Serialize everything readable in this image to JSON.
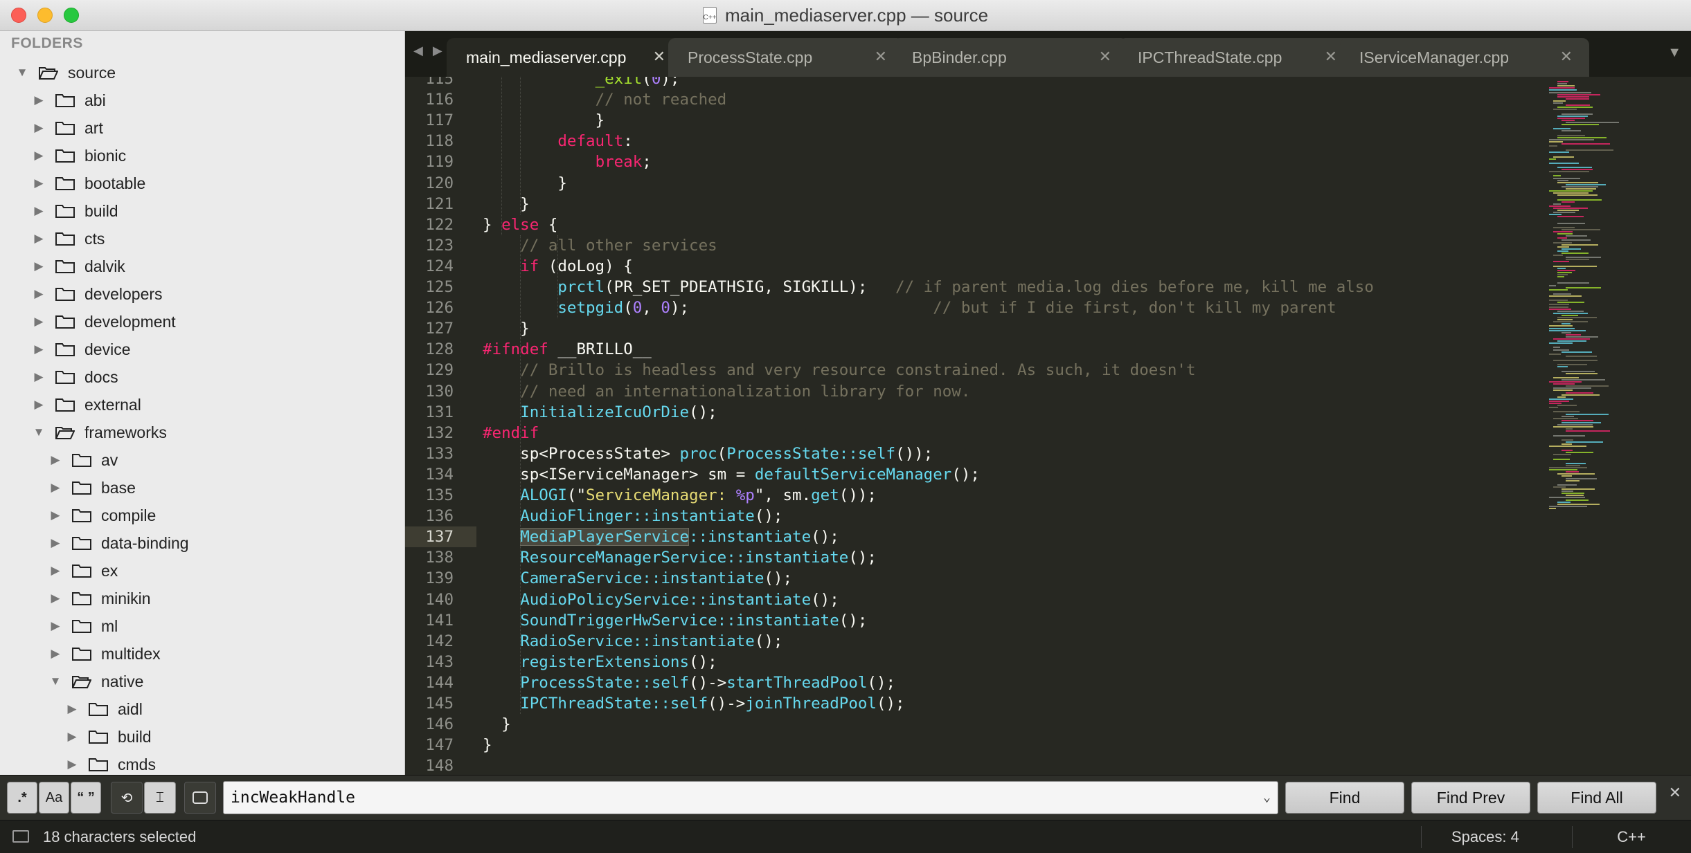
{
  "window": {
    "title": "main_mediaserver.cpp — source",
    "file_icon_label": "C++"
  },
  "sidebar": {
    "header": "FOLDERS",
    "items": [
      {
        "label": "source",
        "depth": 0,
        "open": true
      },
      {
        "label": "abi",
        "depth": 1,
        "open": false
      },
      {
        "label": "art",
        "depth": 1,
        "open": false
      },
      {
        "label": "bionic",
        "depth": 1,
        "open": false
      },
      {
        "label": "bootable",
        "depth": 1,
        "open": false
      },
      {
        "label": "build",
        "depth": 1,
        "open": false
      },
      {
        "label": "cts",
        "depth": 1,
        "open": false
      },
      {
        "label": "dalvik",
        "depth": 1,
        "open": false
      },
      {
        "label": "developers",
        "depth": 1,
        "open": false
      },
      {
        "label": "development",
        "depth": 1,
        "open": false
      },
      {
        "label": "device",
        "depth": 1,
        "open": false
      },
      {
        "label": "docs",
        "depth": 1,
        "open": false
      },
      {
        "label": "external",
        "depth": 1,
        "open": false
      },
      {
        "label": "frameworks",
        "depth": 1,
        "open": true
      },
      {
        "label": "av",
        "depth": 2,
        "open": false
      },
      {
        "label": "base",
        "depth": 2,
        "open": false
      },
      {
        "label": "compile",
        "depth": 2,
        "open": false
      },
      {
        "label": "data-binding",
        "depth": 2,
        "open": false
      },
      {
        "label": "ex",
        "depth": 2,
        "open": false
      },
      {
        "label": "minikin",
        "depth": 2,
        "open": false
      },
      {
        "label": "ml",
        "depth": 2,
        "open": false
      },
      {
        "label": "multidex",
        "depth": 2,
        "open": false
      },
      {
        "label": "native",
        "depth": 2,
        "open": true
      },
      {
        "label": "aidl",
        "depth": 3,
        "open": false
      },
      {
        "label": "build",
        "depth": 3,
        "open": false
      },
      {
        "label": "cmds",
        "depth": 3,
        "open": false
      }
    ]
  },
  "tabs": [
    {
      "label": "main_mediaserver.cpp",
      "active": true
    },
    {
      "label": "ProcessState.cpp",
      "active": false
    },
    {
      "label": "BpBinder.cpp",
      "active": false
    },
    {
      "label": "IPCThreadState.cpp",
      "active": false
    },
    {
      "label": "IServiceManager.cpp",
      "active": false
    }
  ],
  "editor": {
    "current_line": 137,
    "lines": [
      {
        "n": 115,
        "segs": [
          [
            "",
            "            "
          ],
          [
            "c-call",
            "_exit"
          ],
          [
            "",
            "("
          ],
          [
            "c-num",
            "0"
          ],
          [
            "",
            ");"
          ]
        ]
      },
      {
        "n": 116,
        "segs": [
          [
            "",
            "            "
          ],
          [
            "c-cm",
            "// not reached"
          ]
        ]
      },
      {
        "n": 117,
        "segs": [
          [
            "",
            "            }"
          ]
        ]
      },
      {
        "n": 118,
        "segs": [
          [
            "",
            "        "
          ],
          [
            "c-kw",
            "default"
          ],
          [
            "",
            ":"
          ]
        ]
      },
      {
        "n": 119,
        "segs": [
          [
            "",
            "            "
          ],
          [
            "c-kw",
            "break"
          ],
          [
            "",
            ";"
          ]
        ]
      },
      {
        "n": 120,
        "segs": [
          [
            "",
            "        }"
          ]
        ]
      },
      {
        "n": 121,
        "segs": [
          [
            "",
            "    }"
          ]
        ]
      },
      {
        "n": 122,
        "segs": [
          [
            "",
            "} "
          ],
          [
            "c-kw",
            "else"
          ],
          [
            "",
            " {"
          ]
        ]
      },
      {
        "n": 123,
        "segs": [
          [
            "",
            "    "
          ],
          [
            "c-cm",
            "// all other services"
          ]
        ]
      },
      {
        "n": 124,
        "segs": [
          [
            "",
            "    "
          ],
          [
            "c-kw",
            "if"
          ],
          [
            "",
            " (doLog) {"
          ]
        ]
      },
      {
        "n": 125,
        "segs": [
          [
            "",
            "        "
          ],
          [
            "c-fn",
            "prctl"
          ],
          [
            "",
            "(PR_SET_PDEATHSIG, SIGKILL);   "
          ],
          [
            "c-cm",
            "// if parent media.log dies before me, kill me also"
          ]
        ]
      },
      {
        "n": 126,
        "segs": [
          [
            "",
            "        "
          ],
          [
            "c-fn",
            "setpgid"
          ],
          [
            "",
            "("
          ],
          [
            "c-num",
            "0"
          ],
          [
            "",
            ", "
          ],
          [
            "c-num",
            "0"
          ],
          [
            "",
            ");                          "
          ],
          [
            "c-cm",
            "// but if I die first, don't kill my parent"
          ]
        ]
      },
      {
        "n": 127,
        "segs": [
          [
            "",
            "    }"
          ]
        ]
      },
      {
        "n": 128,
        "segs": [
          [
            "c-kw",
            "#ifndef"
          ],
          [
            "",
            " __BRILLO__"
          ]
        ]
      },
      {
        "n": 129,
        "segs": [
          [
            "",
            "    "
          ],
          [
            "c-cm",
            "// Brillo is headless and very resource constrained. As such, it doesn't"
          ]
        ]
      },
      {
        "n": 130,
        "segs": [
          [
            "",
            "    "
          ],
          [
            "c-cm",
            "// need an internationalization library for now."
          ]
        ]
      },
      {
        "n": 131,
        "segs": [
          [
            "",
            "    "
          ],
          [
            "c-fn",
            "InitializeIcuOrDie"
          ],
          [
            "",
            "();"
          ]
        ]
      },
      {
        "n": 132,
        "segs": [
          [
            "c-kw",
            "#endif"
          ]
        ]
      },
      {
        "n": 133,
        "segs": [
          [
            "",
            "    sp<ProcessState> "
          ],
          [
            "c-fn",
            "proc"
          ],
          [
            "",
            "("
          ],
          [
            "c-fn",
            "ProcessState::self"
          ],
          [
            "",
            "());"
          ]
        ]
      },
      {
        "n": 134,
        "segs": [
          [
            "",
            "    sp<IServiceManager> sm = "
          ],
          [
            "c-fn",
            "defaultServiceManager"
          ],
          [
            "",
            "();"
          ]
        ]
      },
      {
        "n": 135,
        "segs": [
          [
            "",
            "    "
          ],
          [
            "c-fn",
            "ALOGI"
          ],
          [
            "",
            "(\""
          ],
          [
            "c-str",
            "ServiceManager: "
          ],
          [
            "c-fmt",
            "%p"
          ],
          [
            "",
            "\", sm."
          ],
          [
            "c-fn",
            "get"
          ],
          [
            "",
            "());"
          ]
        ]
      },
      {
        "n": 136,
        "segs": [
          [
            "",
            "    "
          ],
          [
            "c-fn",
            "AudioFlinger::instantiate"
          ],
          [
            "",
            "();"
          ]
        ]
      },
      {
        "n": 137,
        "segs": [
          [
            "",
            "    "
          ],
          [
            "c-fn sel",
            "MediaPlayerService"
          ],
          [
            "c-fn",
            "::instantiate"
          ],
          [
            "",
            "();"
          ]
        ]
      },
      {
        "n": 138,
        "segs": [
          [
            "",
            "    "
          ],
          [
            "c-fn",
            "ResourceManagerService::instantiate"
          ],
          [
            "",
            "();"
          ]
        ]
      },
      {
        "n": 139,
        "segs": [
          [
            "",
            "    "
          ],
          [
            "c-fn",
            "CameraService::instantiate"
          ],
          [
            "",
            "();"
          ]
        ]
      },
      {
        "n": 140,
        "segs": [
          [
            "",
            "    "
          ],
          [
            "c-fn",
            "AudioPolicyService::instantiate"
          ],
          [
            "",
            "();"
          ]
        ]
      },
      {
        "n": 141,
        "segs": [
          [
            "",
            "    "
          ],
          [
            "c-fn",
            "SoundTriggerHwService::instantiate"
          ],
          [
            "",
            "();"
          ]
        ]
      },
      {
        "n": 142,
        "segs": [
          [
            "",
            "    "
          ],
          [
            "c-fn",
            "RadioService::instantiate"
          ],
          [
            "",
            "();"
          ]
        ]
      },
      {
        "n": 143,
        "segs": [
          [
            "",
            "    "
          ],
          [
            "c-fn",
            "registerExtensions"
          ],
          [
            "",
            "();"
          ]
        ]
      },
      {
        "n": 144,
        "segs": [
          [
            "",
            "    "
          ],
          [
            "c-fn",
            "ProcessState::self"
          ],
          [
            "",
            "()->"
          ],
          [
            "c-fn",
            "startThreadPool"
          ],
          [
            "",
            "();"
          ]
        ]
      },
      {
        "n": 145,
        "segs": [
          [
            "",
            "    "
          ],
          [
            "c-fn",
            "IPCThreadState::self"
          ],
          [
            "",
            "()->"
          ],
          [
            "c-fn",
            "joinThreadPool"
          ],
          [
            "",
            "();"
          ]
        ]
      },
      {
        "n": 146,
        "segs": [
          [
            "",
            "  }"
          ]
        ]
      },
      {
        "n": 147,
        "segs": [
          [
            "",
            "}"
          ]
        ]
      },
      {
        "n": 148,
        "segs": [
          [
            "",
            ""
          ]
        ]
      }
    ]
  },
  "find": {
    "query": "incWeakHandle",
    "regex_label": ".*",
    "case_label": "Aa",
    "word_label": "“ ”",
    "find_label": "Find",
    "find_prev_label": "Find Prev",
    "find_all_label": "Find All"
  },
  "status": {
    "selection": "18 characters selected",
    "indent": "Spaces: 4",
    "syntax": "C++"
  },
  "colors": {
    "keyword": "#f92672",
    "function": "#66d9ef",
    "comment": "#75715e",
    "number": "#ae81ff",
    "string": "#e6db74",
    "background": "#272822"
  }
}
